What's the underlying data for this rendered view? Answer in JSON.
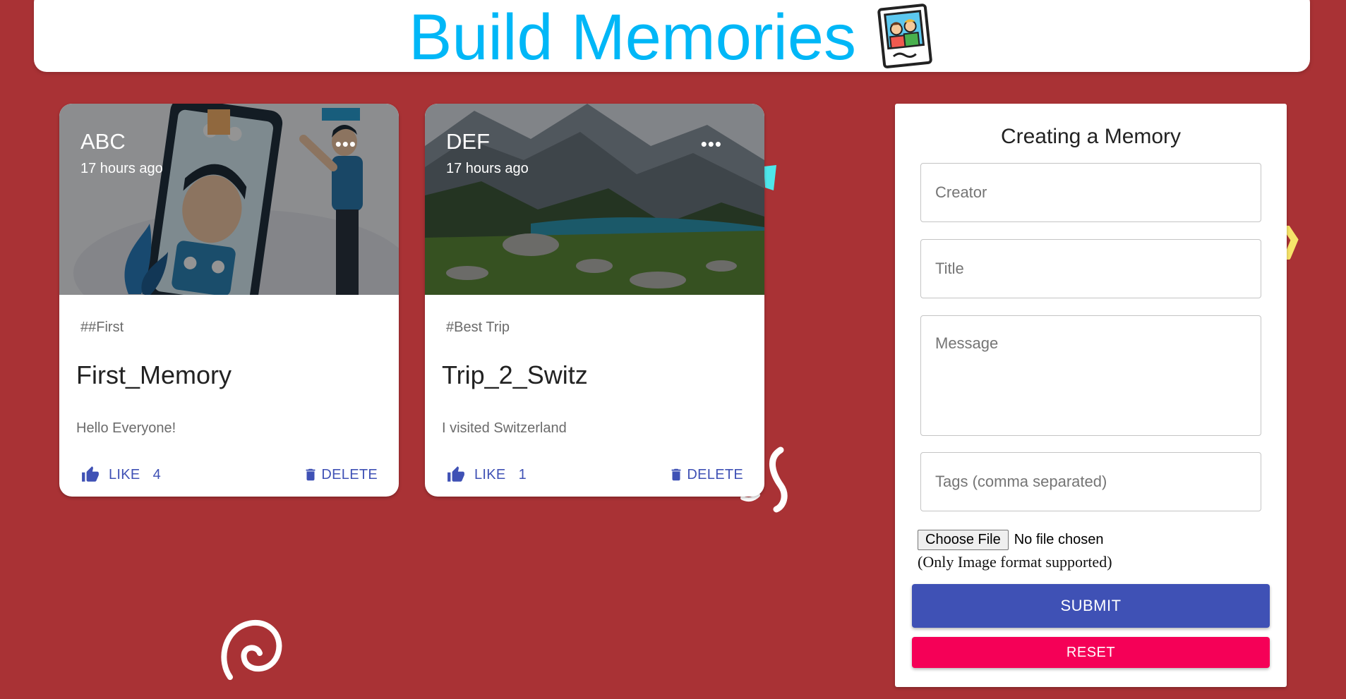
{
  "app": {
    "title": "Build Memories",
    "logo_icon": "photo-memories-icon",
    "accent_color": "#00b7f7",
    "background_color": "#a93235"
  },
  "posts": [
    {
      "creator": "ABC",
      "time": "17 hours ago",
      "more_icon": "more-horizontal-icon",
      "tags": "##First",
      "title": "First_Memory",
      "message": "Hello Everyone!",
      "like_label": "LIKE",
      "like_count": "4",
      "delete_label": "DELETE"
    },
    {
      "creator": "DEF",
      "time": "17 hours ago",
      "more_icon": "more-horizontal-icon",
      "tags": "#Best Trip",
      "title": "Trip_2_Switz",
      "message": "I visited Switzerland",
      "like_label": "LIKE",
      "like_count": "1",
      "delete_label": "DELETE"
    }
  ],
  "form": {
    "title": "Creating a Memory",
    "creator_placeholder": "Creator",
    "title_placeholder": "Title",
    "message_placeholder": "Message",
    "tags_placeholder": "Tags (comma separated)",
    "file_button": "Choose File",
    "file_status": "No file chosen",
    "file_note": "(Only Image format supported)",
    "submit_label": "SUBMIT",
    "reset_label": "RESET",
    "submit_color": "#3f51b5",
    "reset_color": "#f50057"
  }
}
